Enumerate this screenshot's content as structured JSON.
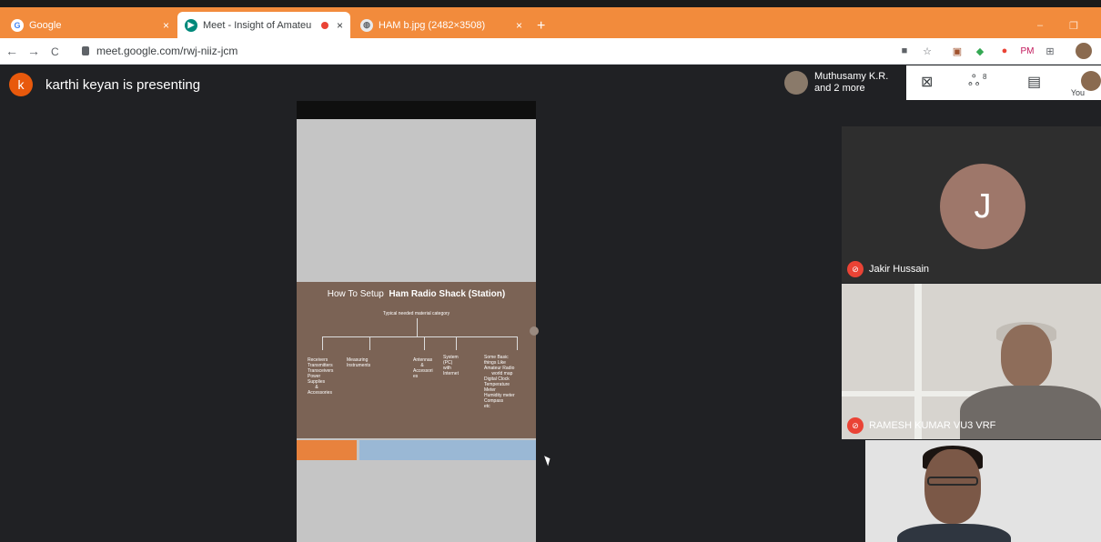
{
  "browser": {
    "tabs": [
      {
        "title": "Google",
        "icon": "google-icon",
        "close": "×"
      },
      {
        "title": "Meet - Insight of Amateur Ra",
        "icon": "meet-icon",
        "close": "×"
      },
      {
        "title": "HAM b.jpg (2482×3508)",
        "icon": "globe-icon",
        "close": "×"
      }
    ],
    "new_tab": "+",
    "window_controls": {
      "minimize": "–",
      "restore": "❐"
    },
    "nav": {
      "back": "←",
      "forward": "→",
      "reload": "C"
    },
    "url": "meet.google.com/rwj-niiz-jcm",
    "extensions": [
      "■",
      "☆",
      "▣",
      "◆",
      "●",
      "PM",
      "⊞"
    ]
  },
  "meet": {
    "presenter_initial": "k",
    "presenter_text": "karthi keyan is presenting",
    "participants_line1": "Muthusamy K.R.",
    "participants_line2": "and 2 more",
    "toolbar_icons": {
      "layout": "⊠",
      "people": "ஃ",
      "people_count": "8",
      "chat": "▤"
    },
    "you_label": "You"
  },
  "slide": {
    "title_prefix": "How To Setup",
    "title_bold": "Ham Radio Shack (Station)",
    "subtitle": "Typical needed material category",
    "columns": [
      "Receivers\nTransmitters\nTransceivers\nPower\nSupplies\n      &\nAccessories",
      "Measuring\nInstruments",
      "Antennas\n      &\nAccessori\nes",
      "System\n(PC)\nwith\nInternet",
      "Some Basic\nthings Like\nAmateur Radio\n      world map\nDigital Clock\nTemperature\nMeter\nHumidity meter\nCompass\netc"
    ]
  },
  "tiles": [
    {
      "initial": "J",
      "name": "Jakir Hussain"
    },
    {
      "name": "RAMESH KUMAR VU3 VRF"
    },
    {
      "name": ""
    }
  ],
  "colors": {
    "tabbar": "#f28b3c",
    "meet_bg": "#202124",
    "mic_off": "#ea4335",
    "slide_brown": "#7b6355"
  }
}
